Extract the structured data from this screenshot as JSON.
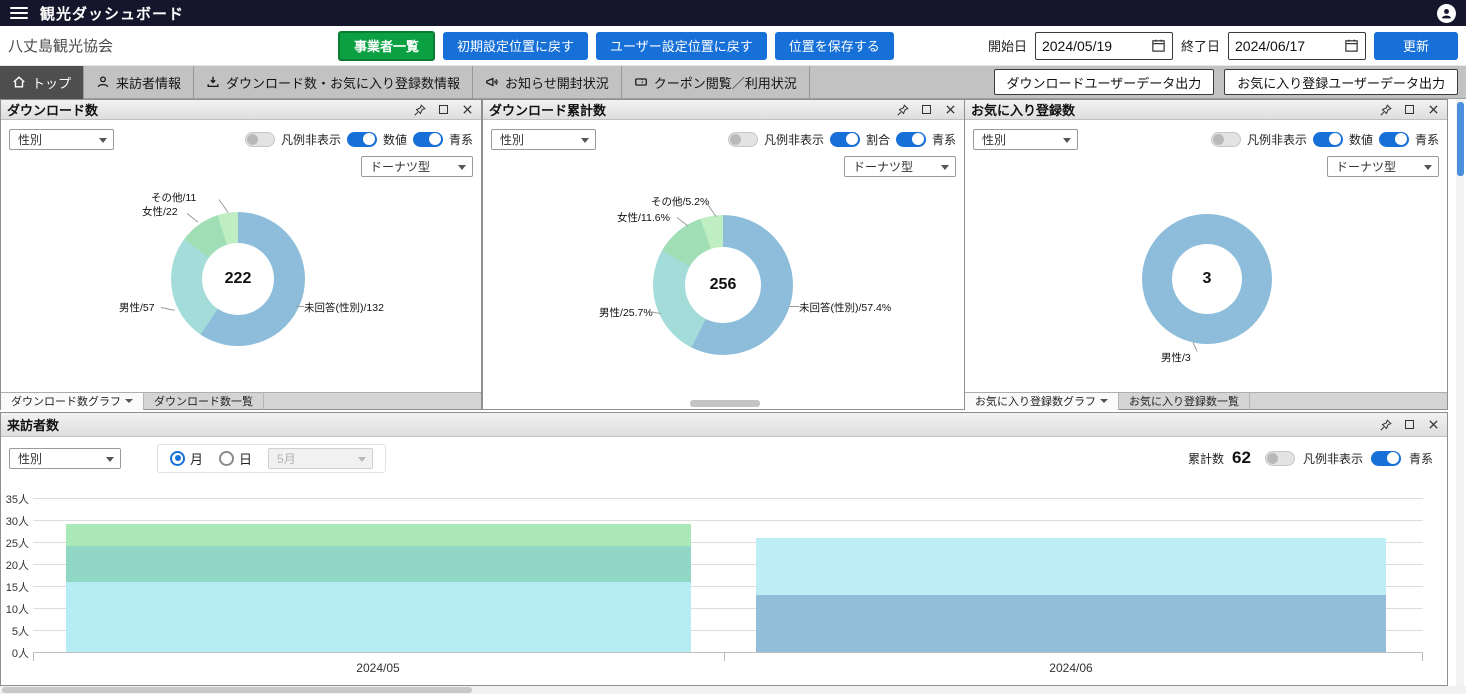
{
  "topbar": {
    "title": "観光ダッシュボード"
  },
  "toolbar": {
    "org_name": "八丈島観光協会",
    "buttons": {
      "business_list": "事業者一覧",
      "reset_default": "初期設定位置に戻す",
      "reset_user": "ユーザー設定位置に戻す",
      "save_position": "位置を保存する",
      "update": "更新"
    },
    "date_range": {
      "start_label": "開始日",
      "start_value": "2024/05/19",
      "end_label": "終了日",
      "end_value": "2024/06/17"
    }
  },
  "tabs": {
    "items": [
      {
        "label": "トップ",
        "icon": "home-icon",
        "active": true
      },
      {
        "label": "来訪者情報",
        "icon": "person-icon",
        "active": false
      },
      {
        "label": "ダウンロード数・お気に入り登録数情報",
        "icon": "download-icon",
        "active": false
      },
      {
        "label": "お知らせ開封状況",
        "icon": "megaphone-icon",
        "active": false
      },
      {
        "label": "クーポン閲覧／利用状況",
        "icon": "ticket-icon",
        "active": false
      }
    ],
    "export_buttons": [
      "ダウンロードユーザーデータ出力",
      "お気に入り登録ユーザーデータ出力"
    ]
  },
  "panels": {
    "download": {
      "title": "ダウンロード数",
      "filter": "性別",
      "toggles": [
        "凡例非表示",
        "数値",
        "青系"
      ],
      "chart_type": "ドーナツ型",
      "footer_tabs": [
        "ダウンロード数グラフ",
        "ダウンロード数一覧"
      ]
    },
    "download_total": {
      "title": "ダウンロード累計数",
      "filter": "性別",
      "toggles": [
        "凡例非表示",
        "割合",
        "青系"
      ],
      "chart_type": "ドーナツ型"
    },
    "favorites": {
      "title": "お気に入り登録数",
      "filter": "性別",
      "toggles": [
        "凡例非表示",
        "数値",
        "青系"
      ],
      "chart_type": "ドーナツ型",
      "footer_tabs": [
        "お気に入り登録数グラフ",
        "お気に入り登録数一覧"
      ]
    },
    "visitors": {
      "title": "来訪者数",
      "filter": "性別",
      "period": {
        "month_label": "月",
        "day_label": "日",
        "month_select": "5月"
      },
      "cumulative_label": "累計数",
      "cumulative_value": "62",
      "toggles": [
        "凡例非表示",
        "青系"
      ]
    }
  },
  "chart_data": [
    {
      "type": "pie",
      "variant": "donut",
      "title": "ダウンロード数",
      "center_total": "222",
      "slices": [
        {
          "label": "未回答(性別)/132",
          "name": "未回答(性別)",
          "value": 132,
          "color": "#8dbdda"
        },
        {
          "label": "男性/57",
          "name": "男性",
          "value": 57,
          "color": "#a3dcd8"
        },
        {
          "label": "女性/22",
          "name": "女性",
          "value": 22,
          "color": "#a0dfb6"
        },
        {
          "label": "その他/11",
          "name": "その他",
          "value": 11,
          "color": "#c0eec3"
        }
      ]
    },
    {
      "type": "pie",
      "variant": "donut",
      "title": "ダウンロード累計数",
      "center_total": "256",
      "slices": [
        {
          "label": "未回答(性別)/57.4%",
          "name": "未回答(性別)",
          "value": 57.4,
          "color": "#8dbdda"
        },
        {
          "label": "男性/25.7%",
          "name": "男性",
          "value": 25.7,
          "color": "#a3dcd8"
        },
        {
          "label": "女性/11.6%",
          "name": "女性",
          "value": 11.6,
          "color": "#a0dfb6"
        },
        {
          "label": "その他/5.2%",
          "name": "その他",
          "value": 5.2,
          "color": "#c0eec3"
        }
      ]
    },
    {
      "type": "pie",
      "variant": "donut",
      "title": "お気に入り登録数",
      "center_total": "3",
      "slices": [
        {
          "label": "男性/3",
          "name": "男性",
          "value": 3,
          "color": "#8dbdda"
        }
      ]
    },
    {
      "type": "stacked_bar",
      "title": "来訪者数",
      "x": [
        "2024/05",
        "2024/06"
      ],
      "ylim": [
        0,
        35
      ],
      "ytick_step": 5,
      "yticks": [
        "35人",
        "30人",
        "25人",
        "20人",
        "15人",
        "10人",
        "5人",
        "0人"
      ],
      "cumulative_label": "累計数",
      "cumulative_value": "62",
      "legend_hidden": true,
      "bars": [
        {
          "x": "2024/05",
          "total_estimate": 29,
          "segments": [
            {
              "value": 16,
              "color": "#b6ecf4"
            },
            {
              "value": 8,
              "color": "#90d8c5"
            },
            {
              "value": 5,
              "color": "#abe8b8"
            }
          ]
        },
        {
          "x": "2024/06",
          "total_estimate": 26,
          "segments": [
            {
              "value": 13,
              "color": "#92bed9"
            },
            {
              "value": 13,
              "color": "#bdeef6"
            }
          ]
        }
      ]
    }
  ]
}
